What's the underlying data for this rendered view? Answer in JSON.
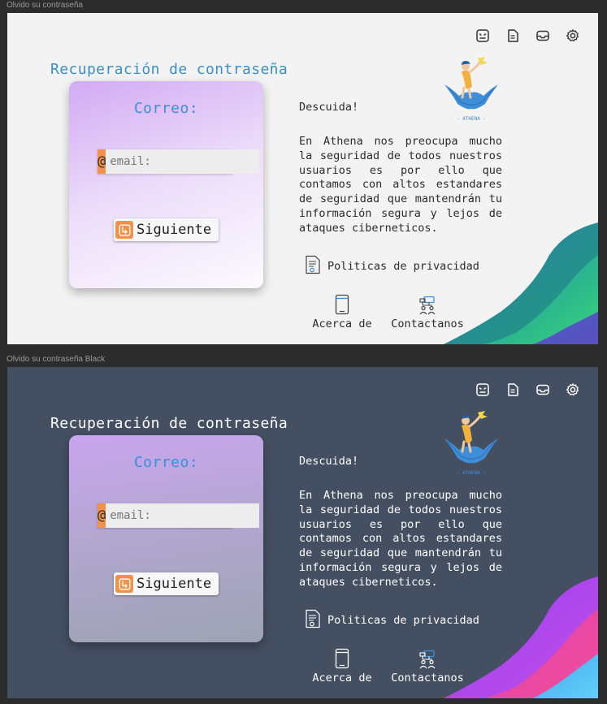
{
  "frames": {
    "light": {
      "label": "Olvido su contraseña"
    },
    "dark": {
      "label": "Olvido su contraseña Black"
    }
  },
  "toolbar": {
    "icons": [
      "face-icon",
      "document-icon",
      "inbox-icon",
      "settings-icon"
    ]
  },
  "heading": "Recuperación de contraseña",
  "card": {
    "title": "Correo:",
    "email_icon": "@",
    "email_placeholder": "email:",
    "email_value": "",
    "next_label": "Siguiente"
  },
  "info": {
    "greeting": "Descuida!",
    "description": "En Athena nos preocupa mucho la seguridad de todos nuestros usuarios es por ello que contamos con altos estandares de seguridad que mantendrán tu información segura y lejos de ataques ciberneticos."
  },
  "links": {
    "privacy": "Politicas de privacidad",
    "about": "Acerca de",
    "contact": "Contactanos"
  },
  "logo": {
    "text": "- ATHENA -"
  },
  "colors": {
    "accent_blue": "#3b8edb",
    "accent_orange": "#f2924a",
    "light_bg": "#f3f3f3",
    "dark_bg": "#444f62"
  }
}
